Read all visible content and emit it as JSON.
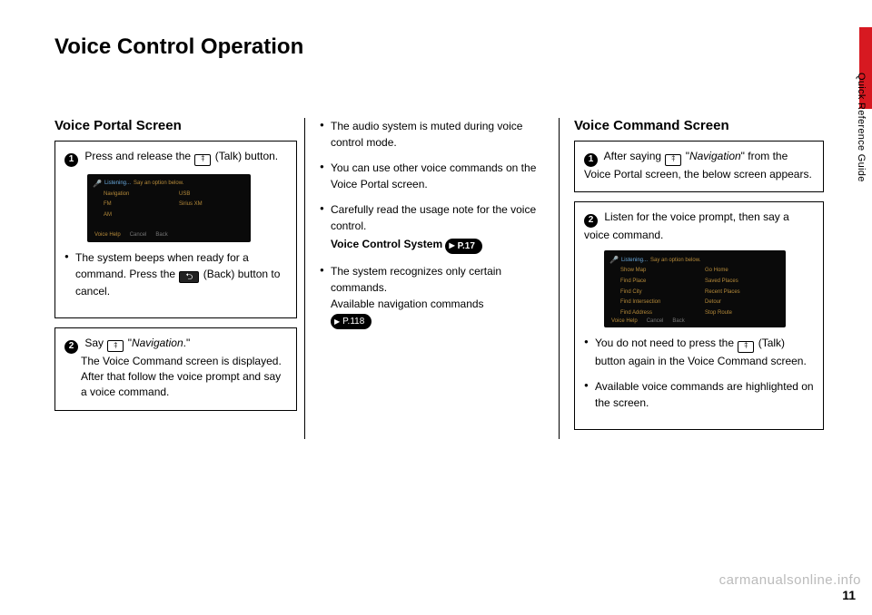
{
  "side_tab_title": "Quick Reference Guide",
  "main_title": "Voice Control Operation",
  "page_number": "11",
  "watermark": "carmanualsonline.info",
  "col1": {
    "heading": "Voice Portal Screen",
    "step1": {
      "num": "1",
      "text_a": "Press and release the ",
      "text_b": " (Talk) button.",
      "screenshot": {
        "listening": "Listening...",
        "prompt": "Say an option below.",
        "items": [
          "Navigation",
          "USB",
          "FM",
          "Sirius XM",
          "AM",
          ""
        ],
        "bottom": [
          "Voice Help",
          "Cancel",
          "Back"
        ]
      },
      "bullet1_a": "The system beeps when ready for a command. Press the ",
      "bullet1_b": " (Back) button to cancel."
    },
    "step2": {
      "num": "2",
      "text_a": "Say ",
      "text_b": " \"",
      "text_c": "Navigation",
      "text_d": ".\"",
      "line2": "The Voice Command screen is displayed.",
      "line3": "After that follow the voice prompt and say a voice command."
    }
  },
  "col2": {
    "bullets": [
      "The audio system is muted during voice control mode.",
      "You can use other voice commands on the Voice Portal screen."
    ],
    "bullet3_text": "Carefully read the usage note for the voice control.",
    "bullet3_label": "Voice Control System",
    "bullet3_ref": "P.17",
    "bullet4_text": "The system recognizes only certain commands.",
    "bullet4_line2": "Available navigation commands",
    "bullet4_ref": "P.118"
  },
  "col3": {
    "heading": "Voice Command Screen",
    "step1": {
      "num": "1",
      "text_a": "After saying ",
      "text_b": " \"",
      "text_c": "Navigation",
      "text_d": "\" from the Voice Portal screen, the below screen appears."
    },
    "step2": {
      "num": "2",
      "text": "Listen for the voice prompt, then say a voice command.",
      "screenshot": {
        "listening": "Listening...",
        "prompt": "Say an option below.",
        "items": [
          "Show Map",
          "Go Home",
          "Find Place",
          "Saved Places",
          "Find City",
          "Recent Places",
          "Find Intersection",
          "Detour",
          "Find Address",
          "Stop Route"
        ],
        "bottom": [
          "Voice Help",
          "Cancel",
          "Back"
        ]
      },
      "bullet1_a": "You do not need to press the ",
      "bullet1_b": " (Talk) button again in the Voice Command screen.",
      "bullet2": "Available voice commands are highlighted on the screen."
    }
  }
}
